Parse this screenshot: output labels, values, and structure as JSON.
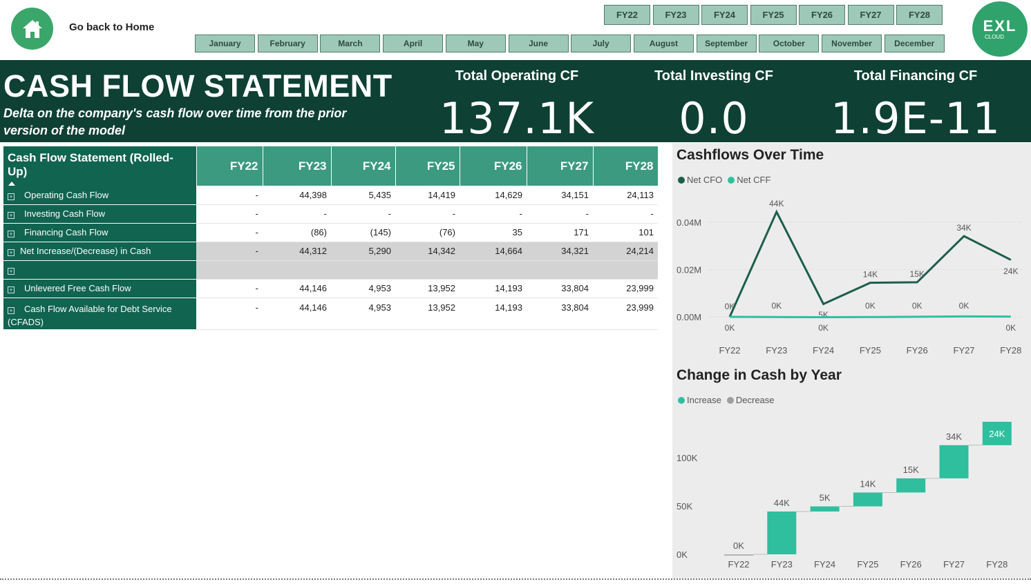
{
  "nav": {
    "home_link": "Go back to Home",
    "fiscal_years": [
      "FY22",
      "FY23",
      "FY24",
      "FY25",
      "FY26",
      "FY27",
      "FY28"
    ],
    "months": [
      "January",
      "February",
      "March",
      "April",
      "May",
      "June",
      "July",
      "August",
      "September",
      "October",
      "November",
      "December"
    ],
    "logo": {
      "line1": "EXL",
      "line2": "CLOUD"
    }
  },
  "banner": {
    "title": "CASH FLOW STATEMENT",
    "subtitle": "Delta on the company's cash flow over time from the prior version of the model",
    "kpis": [
      {
        "label": "Total Operating CF",
        "value": "137.1K"
      },
      {
        "label": "Total Investing CF",
        "value": "0.0"
      },
      {
        "label": "Total Financing CF",
        "value": "1.9E-11"
      }
    ]
  },
  "matrix": {
    "header": "Cash Flow Statement (Rolled-Up)",
    "columns": [
      "FY22",
      "FY23",
      "FY24",
      "FY25",
      "FY26",
      "FY27",
      "FY28"
    ],
    "rows": [
      {
        "label": "Operating Cash Flow",
        "values": [
          "-",
          "44,398",
          "5,435",
          "14,419",
          "14,629",
          "34,151",
          "24,113"
        ],
        "shaded": false
      },
      {
        "label": "Investing Cash Flow",
        "values": [
          "-",
          "-",
          "-",
          "-",
          "-",
          "-",
          "-"
        ],
        "shaded": false
      },
      {
        "label": "Financing Cash Flow",
        "values": [
          "-",
          "(86)",
          "(145)",
          "(76)",
          "35",
          "171",
          "101"
        ],
        "shaded": false
      },
      {
        "label": "Net Increase/(Decrease) in Cash",
        "values": [
          "-",
          "44,312",
          "5,290",
          "14,342",
          "14,664",
          "34,321",
          "24,214"
        ],
        "shaded": true
      },
      {
        "label": "",
        "values": [
          "",
          "",
          "",
          "",
          "",
          "",
          ""
        ],
        "shaded": true
      },
      {
        "label": "Unlevered Free Cash Flow",
        "values": [
          "-",
          "44,146",
          "4,953",
          "13,952",
          "14,193",
          "33,804",
          "23,999"
        ],
        "shaded": false
      },
      {
        "label": "Cash Flow Available for Debt Service (CFADS)",
        "values": [
          "-",
          "44,146",
          "4,953",
          "13,952",
          "14,193",
          "33,804",
          "23,999"
        ],
        "shaded": false
      }
    ]
  },
  "chart_data": [
    {
      "type": "line",
      "title": "Cashflows Over Time",
      "categories": [
        "FY22",
        "FY23",
        "FY24",
        "FY25",
        "FY26",
        "FY27",
        "FY28"
      ],
      "series": [
        {
          "name": "Net CFO",
          "color": "#1a5e4c",
          "values": [
            0,
            44398,
            5435,
            14419,
            14629,
            34151,
            24113
          ],
          "labels": [
            "0K",
            "44K",
            "5K",
            "14K",
            "15K",
            "34K",
            "24K"
          ]
        },
        {
          "name": "Net CFF",
          "color": "#2fbf9f",
          "values": [
            0,
            -86,
            -145,
            -76,
            35,
            171,
            101
          ],
          "labels": [
            "0K",
            "0K",
            "0K",
            "0K",
            "0K",
            "0K",
            "0K"
          ]
        }
      ],
      "y_ticks": [
        "0.00M",
        "0.02M",
        "0.04M"
      ],
      "ylim": [
        0,
        0.04
      ],
      "legend_position": "top-left"
    },
    {
      "type": "waterfall",
      "title": "Change in Cash by Year",
      "categories": [
        "FY22",
        "FY23",
        "FY24",
        "FY25",
        "FY26",
        "FY27",
        "FY28"
      ],
      "values": [
        0,
        44312,
        5290,
        14342,
        14664,
        34321,
        24214
      ],
      "labels": [
        "0K",
        "44K",
        "5K",
        "14K",
        "15K",
        "34K",
        "24K"
      ],
      "legend": [
        {
          "name": "Increase",
          "color": "#2fbf9f"
        },
        {
          "name": "Decrease",
          "color": "#9e9e9e"
        }
      ],
      "y_ticks": [
        "0K",
        "50K",
        "100K"
      ],
      "ylim": [
        0,
        137143
      ],
      "legend_position": "top-left"
    }
  ]
}
